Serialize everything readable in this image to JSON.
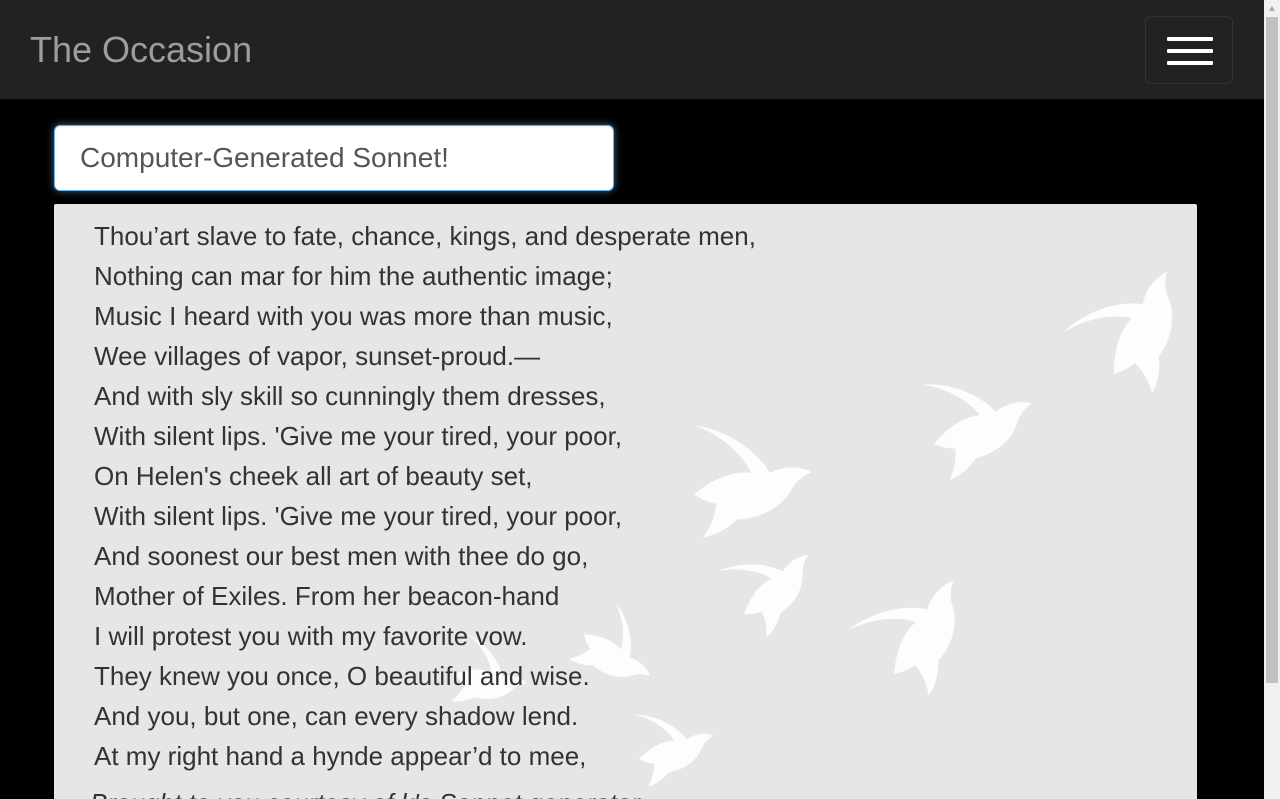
{
  "navbar": {
    "brand": "The Occasion",
    "menu_icon": "hamburger-menu-icon"
  },
  "title_input": {
    "value": "Computer-Generated Sonnet!"
  },
  "poem": {
    "lines": [
      "Thou’art slave to fate, chance, kings, and desperate men,",
      "Nothing can mar for him the authentic image;",
      "Music I heard with you was more than music,",
      "Wee villages of vapor, sunset-proud.—",
      "And with sly skill so cunningly them dresses,",
      "With silent lips. 'Give me your tired, your poor,",
      "On Helen's cheek all art of beauty set,",
      "With silent lips. 'Give me your tired, your poor,",
      "And soonest our best men with thee do go,",
      "Mother of Exiles. From her beacon-hand",
      "I will protest you with my favorite vow.",
      "They knew you once, O beautiful and wise.",
      "And you, but one, can every shadow lend.",
      "At my right hand a hynde appear’d to mee,"
    ],
    "attribution": "Brought to you courtesy of k's Sonnet generator"
  },
  "decoration": {
    "bird_icon": "bird-silhouette-icon",
    "bird_color": "#ffffff",
    "panel_color": "#e6e6e6"
  }
}
